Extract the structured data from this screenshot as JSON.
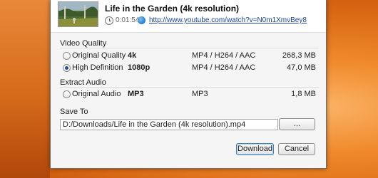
{
  "video": {
    "title": "Life in the Garden (4k resolution)",
    "duration": "0:01:54",
    "url": "http://www.youtube.com/watch?v=N0m1XmvBey8"
  },
  "video_quality": {
    "section_label": "Video Quality",
    "options": [
      {
        "label": "Original Quality",
        "quality": "4k",
        "format": "MP4 / H264 / AAC",
        "size": "268,3 MB",
        "selected": false
      },
      {
        "label": "High Definition",
        "quality": "1080p",
        "format": "MP4 / H264 / AAC",
        "size": "47,0 MB",
        "selected": true
      }
    ]
  },
  "extract_audio": {
    "section_label": "Extract Audio",
    "options": [
      {
        "label": "Original Audio",
        "quality": "MP3",
        "format": "MP3",
        "size": "1,8 MB",
        "selected": false
      }
    ]
  },
  "save_to": {
    "section_label": "Save To",
    "path": "D:/Downloads/Life in the Garden (4k resolution).mp4",
    "browse_label": "..."
  },
  "buttons": {
    "download": "Download",
    "cancel": "Cancel"
  },
  "colors": {
    "accent_link": "#1a3fa6",
    "desktop_orange": "#f08a2c",
    "dialog_bg": "#f5f5f5"
  }
}
